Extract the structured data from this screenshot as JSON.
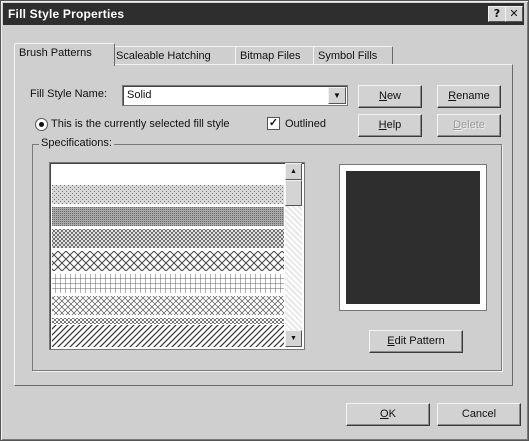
{
  "window": {
    "title": "Fill Style Properties",
    "help_glyph": "?",
    "close_glyph": "✕"
  },
  "tabs": [
    {
      "label": "Brush Patterns",
      "active": true
    },
    {
      "label": "Scaleable Hatching",
      "active": false
    },
    {
      "label": "Bitmap Files",
      "active": false
    },
    {
      "label": "Symbol Fills",
      "active": false
    }
  ],
  "fill_style": {
    "name_label": "Fill Style Name:",
    "name_value": "Solid",
    "dropdown_arrow": "▼"
  },
  "buttons": {
    "new": {
      "mnemonic": "N",
      "rest": "ew"
    },
    "rename": {
      "mnemonic": "R",
      "rest": "ename"
    },
    "help": {
      "mnemonic": "H",
      "rest": "elp"
    },
    "delete": {
      "mnemonic": "D",
      "rest": "elete",
      "enabled": false
    },
    "edit_pattern": {
      "mnemonic": "E",
      "rest": "dit Pattern"
    },
    "ok": {
      "mnemonic": "O",
      "rest": "K"
    },
    "cancel": {
      "label": "Cancel"
    }
  },
  "status": {
    "selected_text": "This is the currently selected fill style",
    "selected": true,
    "outlined_label": "Outlined",
    "outlined_checked": true,
    "check_glyph": "✓"
  },
  "specifications": {
    "label": "Specifications:",
    "patterns": [
      "solid",
      "dotted",
      "dense",
      "crosshatch",
      "diamond",
      "grid",
      "diag-cross",
      "checker",
      "diagonal"
    ],
    "scroll_up": "▲",
    "scroll_down": "▼"
  },
  "preview": {
    "fill_color": "#2e2e2e"
  },
  "colors": {
    "title_bar": "#2e2e2e",
    "dialog_bg": "#cfcfcf"
  }
}
